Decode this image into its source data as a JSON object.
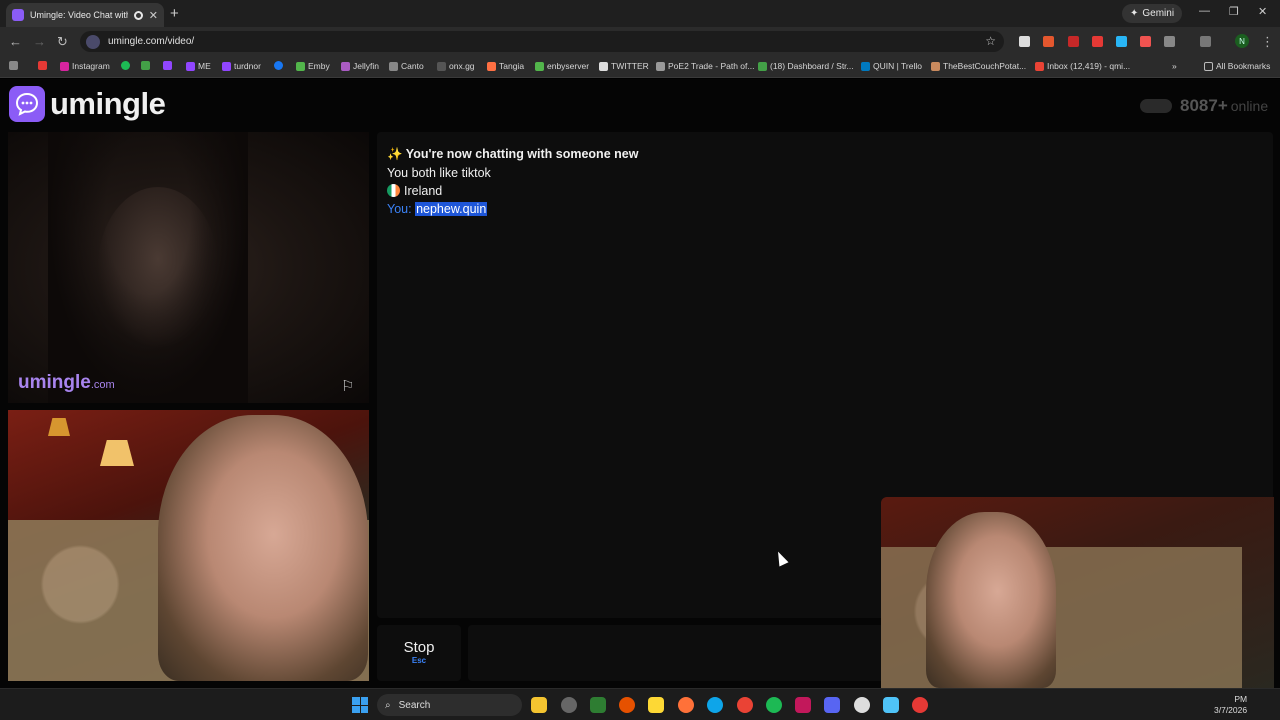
{
  "browser": {
    "tab_title": "Umingle: Video Chat with S",
    "new_tab_icon": "+",
    "gemini_label": "Gemini",
    "url": "umingle.com/video/",
    "profile_initial": "N",
    "all_bookmarks": "All Bookmarks",
    "bookmarks": [
      "Instagram",
      "ME",
      "turdnor",
      "Emby",
      "Jellyfin",
      "Canto",
      "onx.gg",
      "Tangia",
      "enbyserver",
      "TWITTER",
      "PoE2 Trade - Path of...",
      "(18) Dashboard / Str...",
      "QUIN | Trello",
      "TheBestCouchPotat...",
      "Inbox (12,419) - qmi..."
    ]
  },
  "site": {
    "logo": "umingle",
    "online_count": "8087+",
    "online_label": "online",
    "watermark": "umingle",
    "watermark_suffix": ".com"
  },
  "chat": {
    "headline": "✨ You're now chatting with someone new",
    "interest": "You both like tiktok",
    "country": "Ireland",
    "you_label": "You:",
    "you_message": "nephew.quin"
  },
  "controls": {
    "stop_label": "Stop",
    "stop_key": "Esc",
    "message_placeholder": ""
  },
  "taskbar": {
    "search_label": "Search",
    "time": "PM",
    "date": "3/7/2026"
  },
  "colors": {
    "brand": "#8b5cf6",
    "accent_blue": "#3b82f6"
  }
}
